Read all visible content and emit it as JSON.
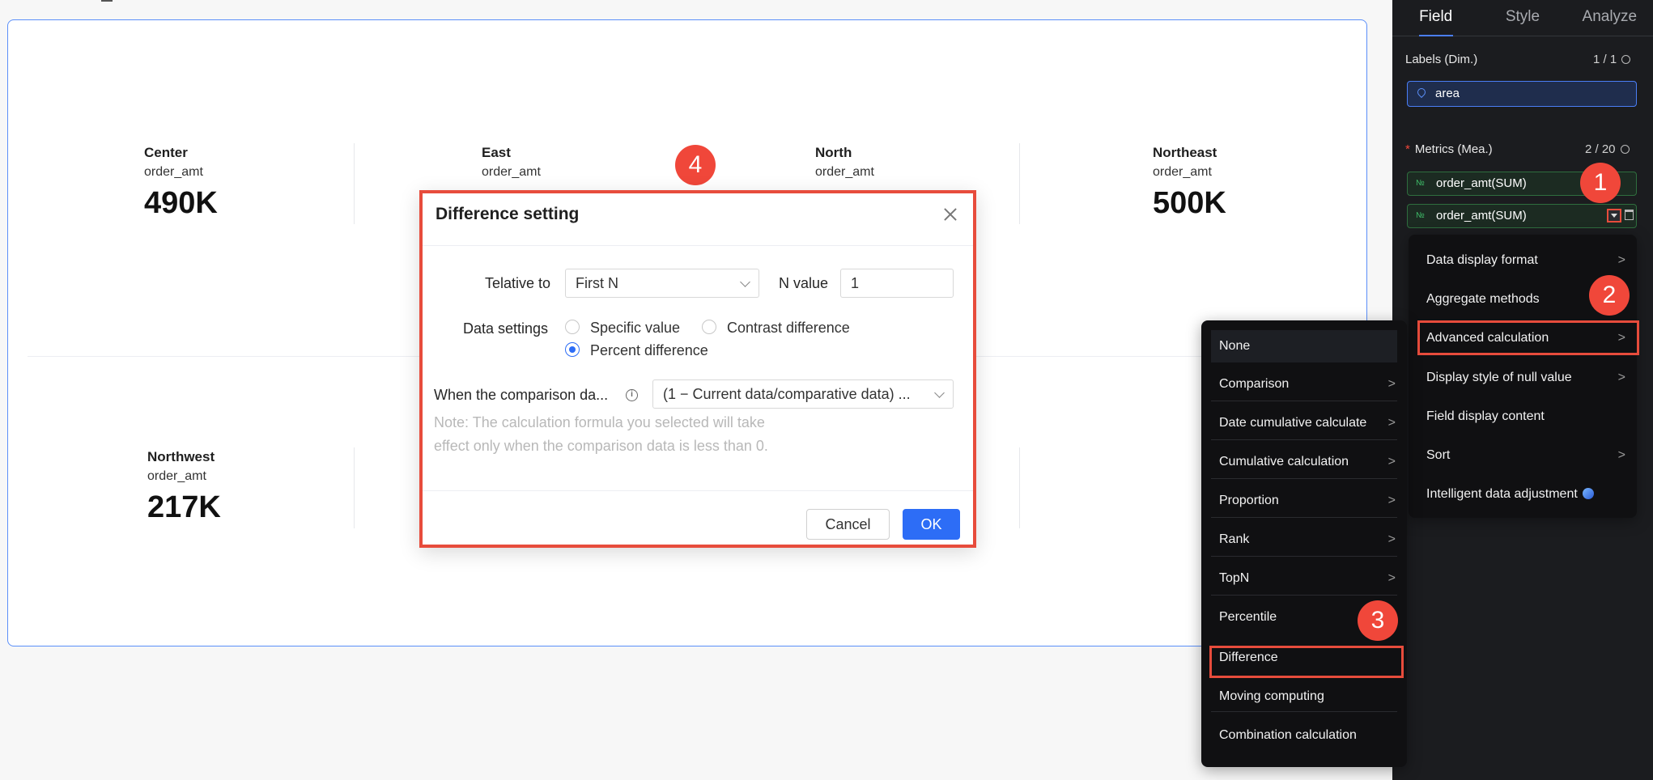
{
  "kpis": [
    {
      "region": "Center",
      "measure": "order_amt",
      "value": "490K"
    },
    {
      "region": "East",
      "measure": "order_amt",
      "value": ""
    },
    {
      "region": "North",
      "measure": "order_amt",
      "value": ""
    },
    {
      "region": "Northeast",
      "measure": "order_amt",
      "value": "500K"
    },
    {
      "region": "Northwest",
      "measure": "order_amt",
      "value": "217K"
    }
  ],
  "panel": {
    "tabs": [
      "Field",
      "Style",
      "Analyze"
    ],
    "labels_title": "Labels (Dim.)",
    "labels_count": "1 / 1",
    "dimension": "area",
    "metrics_title": "Metrics (Mea.)",
    "metrics_count": "2 / 20",
    "metric_type_icon": "№",
    "metrics": [
      "order_amt(SUM)",
      "order_amt(SUM)"
    ]
  },
  "field_menu": {
    "items": [
      "Data display format",
      "Aggregate methods",
      "Advanced calculation",
      "Display style of null value",
      "Field display content",
      "Sort",
      "Intelligent data adjustment"
    ]
  },
  "adv_menu": {
    "items": [
      "None",
      "Comparison",
      "Date cumulative calculate",
      "Cumulative calculation",
      "Proportion",
      "Rank",
      "TopN",
      "Percentile",
      "Difference",
      "Moving computing",
      "Combination calculation"
    ]
  },
  "badges": [
    "1",
    "2",
    "3",
    "4"
  ],
  "dialog": {
    "title": "Difference setting",
    "relative_label": "Telative to",
    "relative_value": "First N",
    "n_label": "N value",
    "n_value": "1",
    "data_settings_label": "Data settings",
    "options": [
      "Specific value",
      "Contrast difference",
      "Percent difference"
    ],
    "selected_option": "Percent difference",
    "comparison_label": "When the comparison da...",
    "comparison_value": "(1 − Current data/comparative data) ...",
    "note_line1": "Note: The calculation formula you selected will take",
    "note_line2": "effect only when the comparison data is less than 0.",
    "cancel": "Cancel",
    "ok": "OK"
  },
  "colors": {
    "accent": "#2d6df6",
    "highlight": "#e74c3c",
    "badge": "#f0473a",
    "panel_bg": "#1b1c1f",
    "metric_green": "#3fbf6a"
  }
}
